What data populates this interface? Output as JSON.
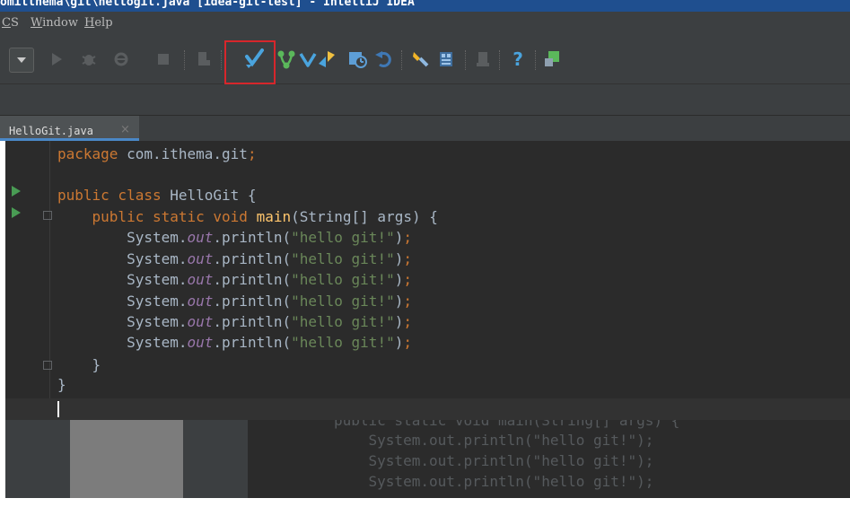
{
  "window": {
    "title_fragment": "omitthema\\git\\hellogit.java [idea-git-test] - IntelliJ IDEA"
  },
  "menu": [
    {
      "label": "CS",
      "mnemonic": "C"
    },
    {
      "label": "Window",
      "mnemonic": "W"
    },
    {
      "label": "Help",
      "mnemonic": "H"
    }
  ],
  "toolbar": {
    "icons": [
      "dropdown-arrow-icon",
      "run-icon",
      "debug-icon",
      "coverage-icon",
      "stop-icon",
      "build-icon",
      "vcs-update-icon",
      "vcs-commit-icon",
      "vcs-push-icon",
      "vcs-history-icon",
      "revert-icon",
      "settings-icon",
      "project-structure-icon",
      "sdk-icon",
      "help-icon",
      "plugin-icon"
    ],
    "highlighted": "vcs-update-icon",
    "highlight_color": "#d7262b"
  },
  "editor": {
    "tab_label": "HelloGit.java",
    "tab_close": "×",
    "lines": [
      "package com.ithema.git;",
      "",
      "public class HelloGit {",
      "    public static void main(String[] args) {",
      "        System.out.println(\"hello git!\");",
      "        System.out.println(\"hello git!\");",
      "        System.out.println(\"hello git!\");",
      "        System.out.println(\"hello git!\");",
      "        System.out.println(\"hello git!\");",
      "        System.out.println(\"hello git!\");",
      "    }",
      "}"
    ]
  },
  "lower_ghost": {
    "lines": [
      "public static void main(String[] args) {",
      "    System.out.println(\"hello git!\");",
      "    System.out.println(\"hello git!\");",
      "    System.out.println(\"hello git!\");"
    ]
  }
}
